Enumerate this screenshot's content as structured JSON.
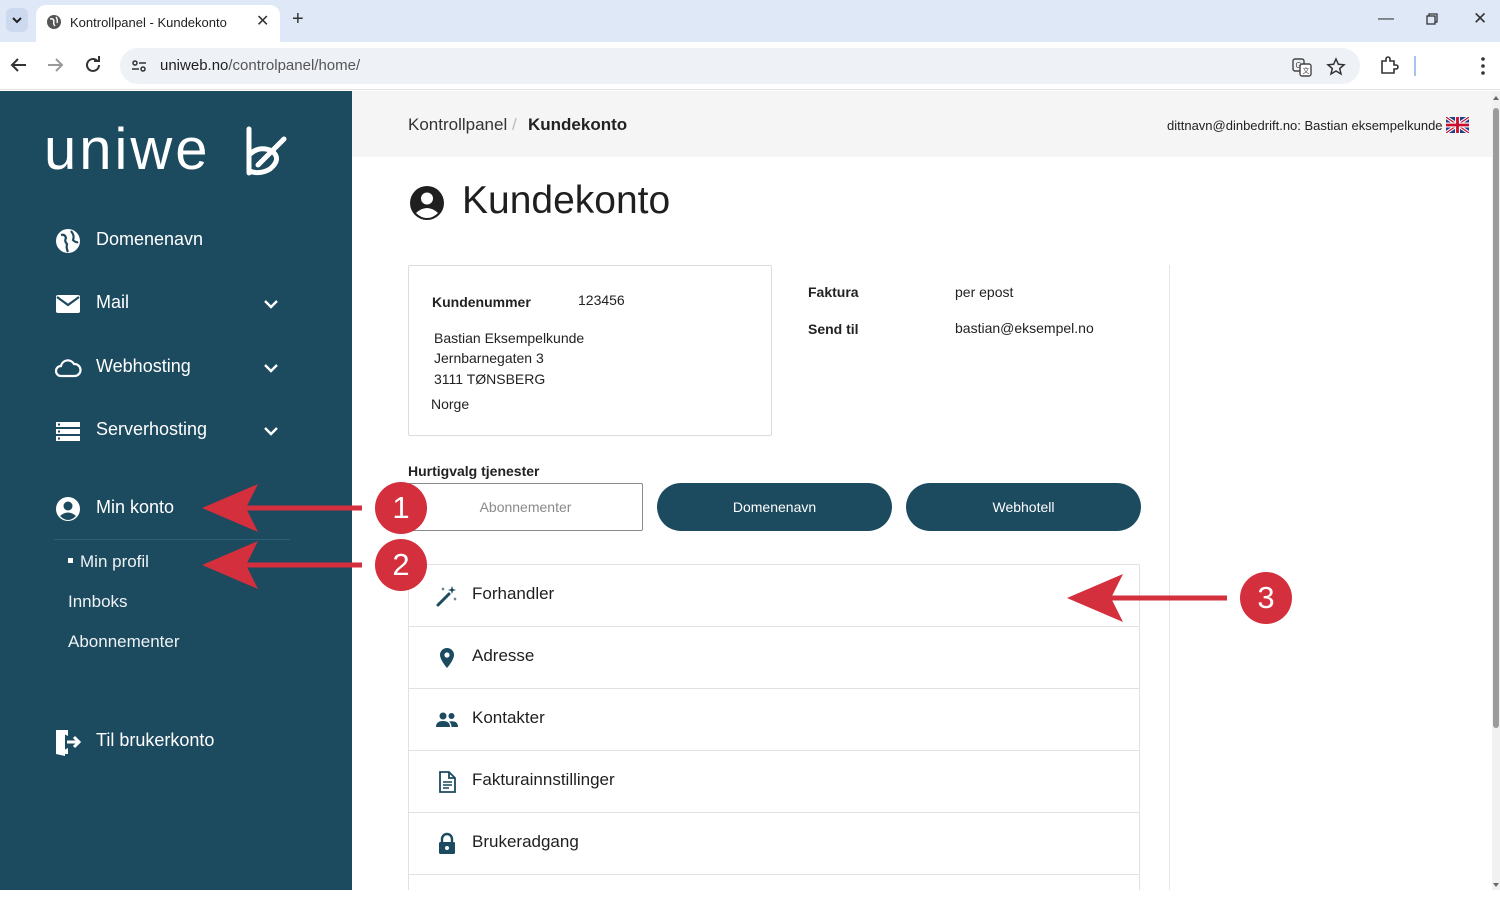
{
  "browser": {
    "tab_title": "Kontrollpanel - Kundekonto",
    "url_host": "uniweb.no",
    "url_path": "/controlpanel/home/"
  },
  "sidebar": {
    "logo_text": "uniweb",
    "items": [
      {
        "label": "Domenenavn",
        "icon": "globe-icon"
      },
      {
        "label": "Mail",
        "icon": "mail-icon",
        "expandable": true
      },
      {
        "label": "Webhosting",
        "icon": "cloud-icon",
        "expandable": true
      },
      {
        "label": "Serverhosting",
        "icon": "server-icon",
        "expandable": true
      },
      {
        "label": "Min konto",
        "icon": "account-circle-icon",
        "expandable": true,
        "expanded": true
      }
    ],
    "subitems": [
      {
        "label": "Min profil",
        "active": true
      },
      {
        "label": "Innboks"
      },
      {
        "label": "Abonnementer"
      }
    ],
    "exit_label": "Til brukerkonto"
  },
  "header": {
    "breadcrumb_root": "Kontrollpanel",
    "breadcrumb_sep": "/",
    "breadcrumb_current": "Kundekonto",
    "user_text": "dittnavn@dinbedrift.no: Bastian eksempelkunde"
  },
  "page": {
    "title": "Kundekonto"
  },
  "customer": {
    "number_label": "Kundenummer",
    "number_value": "123456",
    "name": "Bastian Eksempelkunde",
    "street": "Jernbarnegaten 3",
    "postal": "3111 TØNSBERG",
    "country": "Norge"
  },
  "invoice": {
    "faktura_label": "Faktura",
    "faktura_value": "per epost",
    "send_label": "Send til",
    "send_value": "bastian@eksempel.no"
  },
  "quick": {
    "label": "Hurtigvalg tjenester",
    "buttons": [
      "Abonnementer",
      "Domenenavn",
      "Webhotell"
    ]
  },
  "sections": [
    {
      "label": "Forhandler",
      "icon": "magic-wand-icon"
    },
    {
      "label": "Adresse",
      "icon": "location-pin-icon"
    },
    {
      "label": "Kontakter",
      "icon": "people-icon"
    },
    {
      "label": "Fakturainnstillinger",
      "icon": "document-icon"
    },
    {
      "label": "Brukeradgang",
      "icon": "lock-icon"
    }
  ],
  "annotations": [
    "1",
    "2",
    "3"
  ],
  "colors": {
    "sidebar": "#1c4a5f",
    "accent_red": "#d32f3c",
    "header_bg": "#f5f5f5"
  }
}
